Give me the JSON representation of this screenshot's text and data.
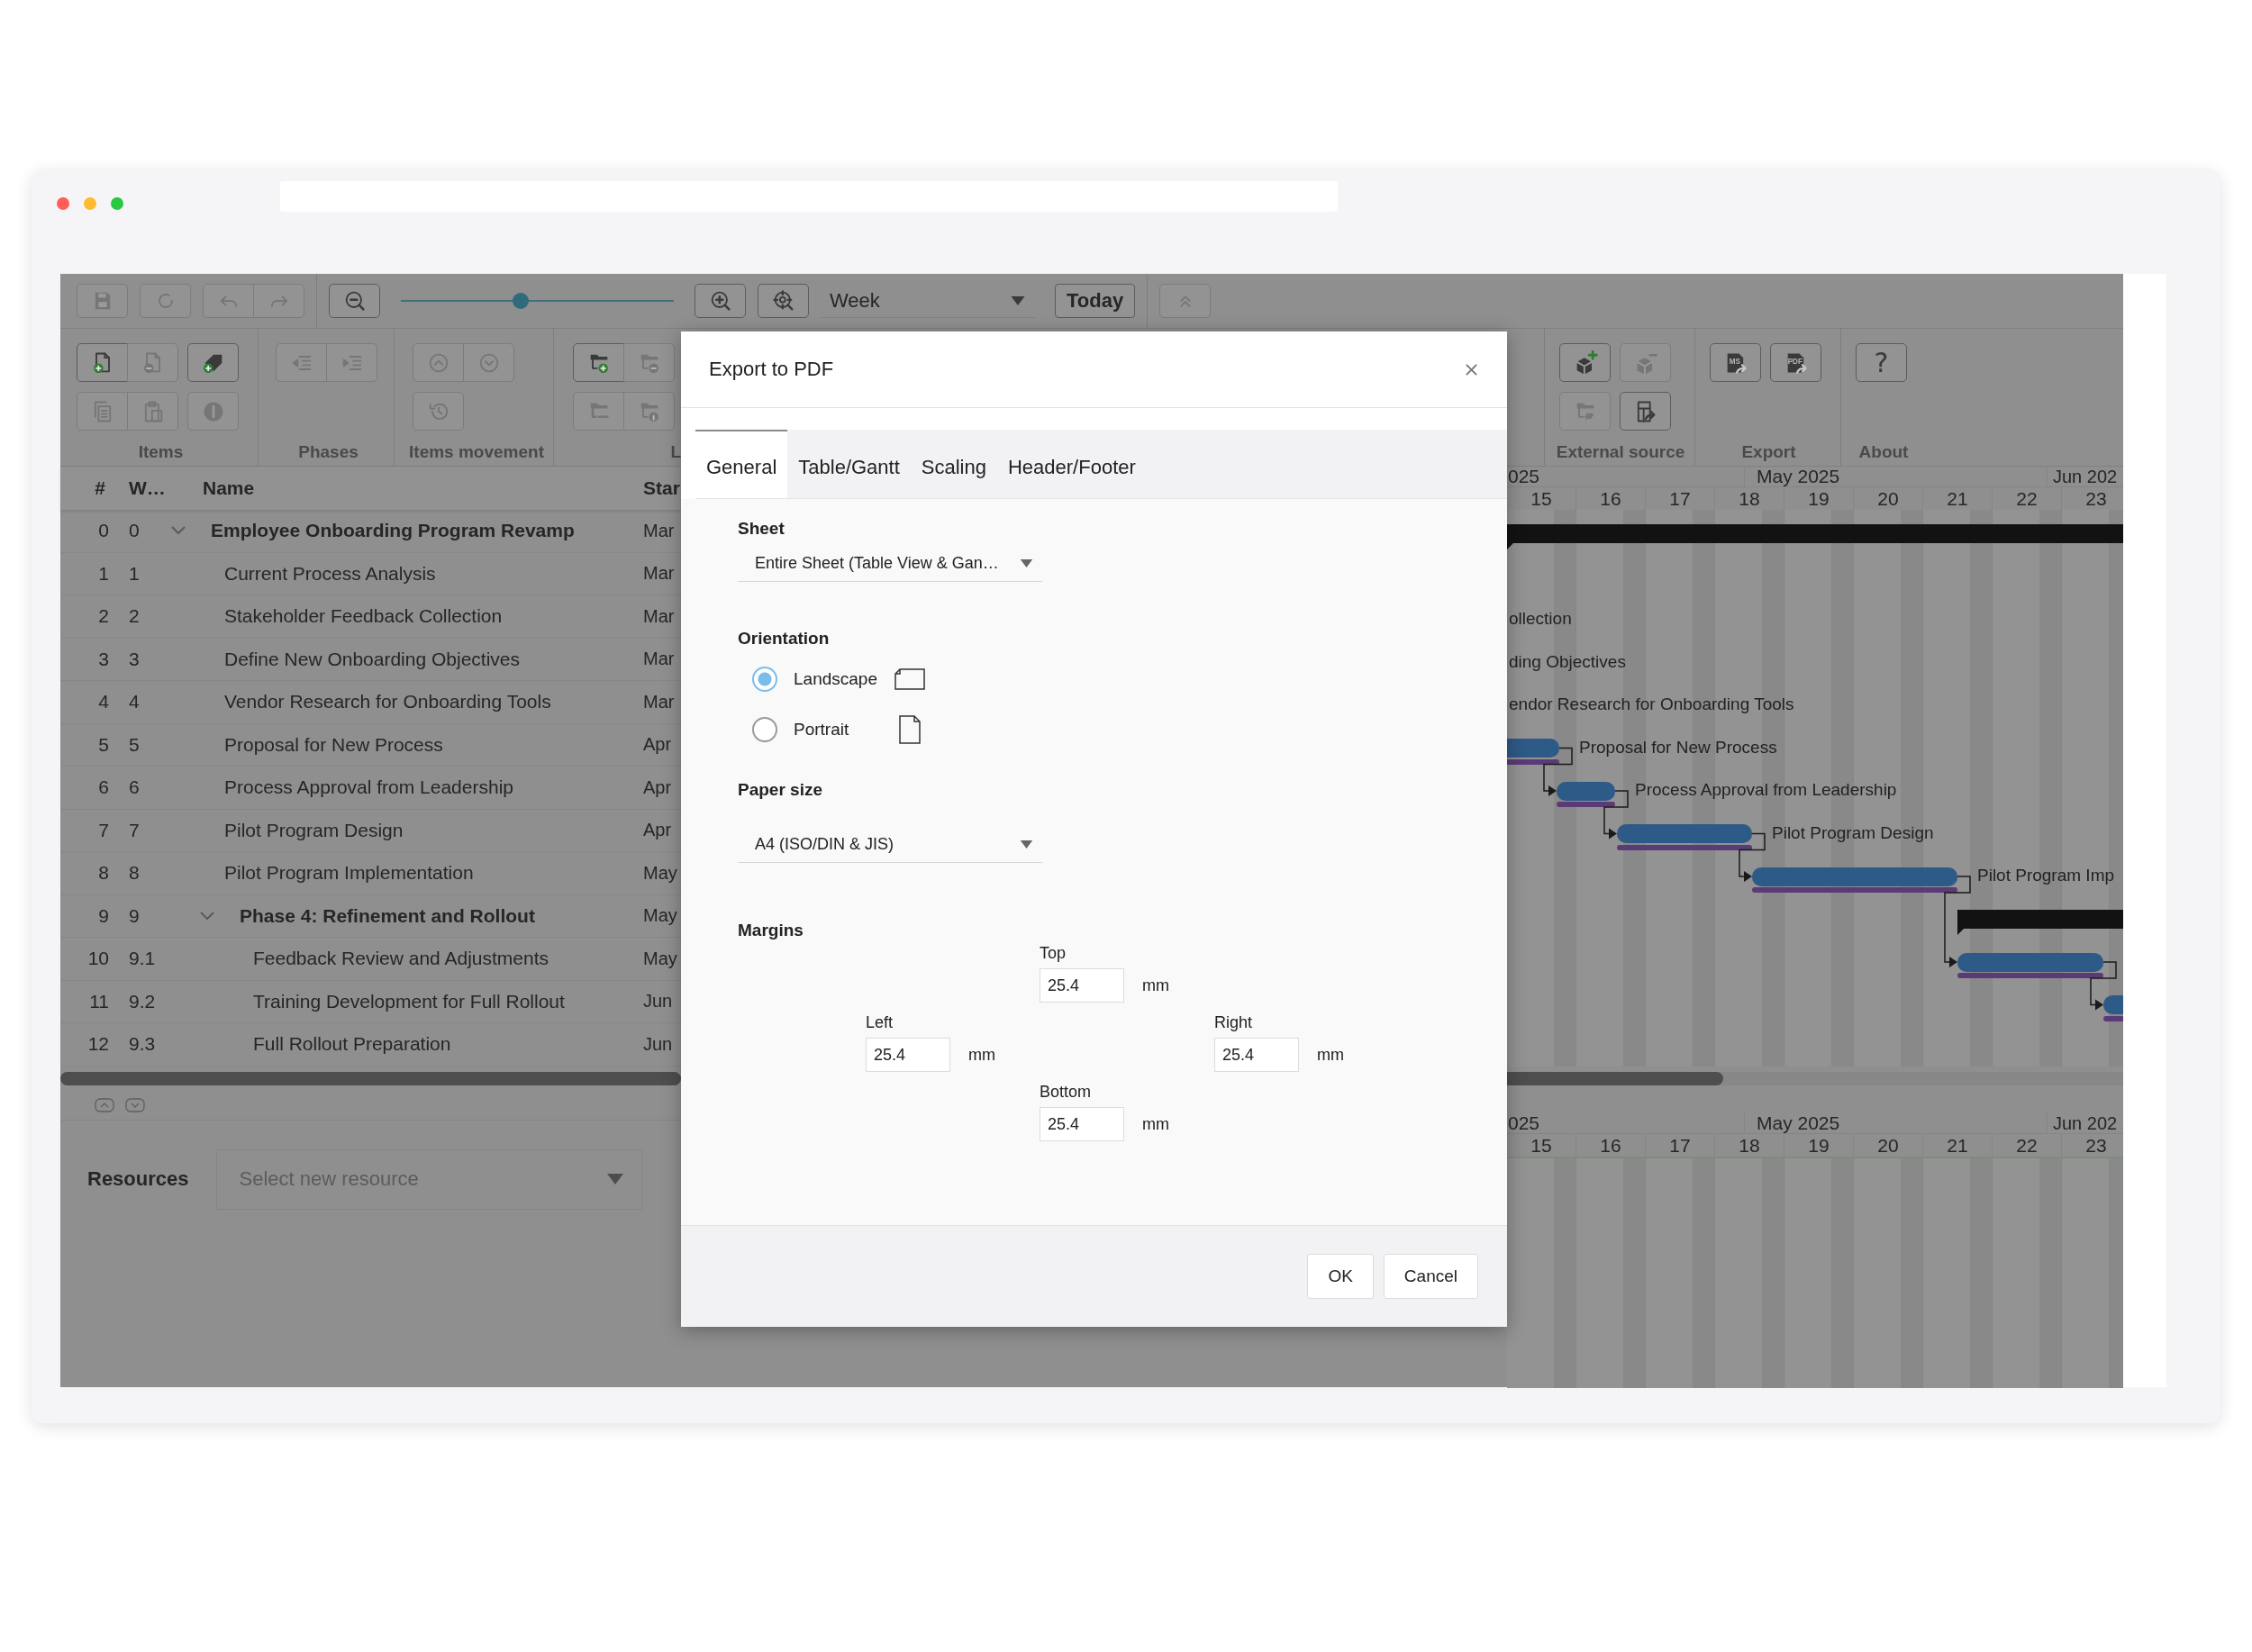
{
  "toolbar": {
    "file_buttons": [
      {
        "kind": "save",
        "disabled": true
      },
      {
        "kind": "refresh",
        "disabled": true
      }
    ],
    "history_buttons": [
      {
        "kind": "undo",
        "disabled": true
      },
      {
        "kind": "redo",
        "disabled": true
      }
    ],
    "zoom_out": {
      "kind": "zoom-out",
      "disabled": false
    },
    "zoom": {
      "level": 0.44
    },
    "view_buttons": [
      {
        "kind": "zoom-in",
        "disabled": false
      },
      {
        "kind": "zoom-fit",
        "disabled": false
      }
    ],
    "scale": {
      "value": "Week"
    },
    "today": {
      "label": "Today"
    },
    "collapse": {
      "kind": "collapse",
      "disabled": true
    }
  },
  "ribbon": {
    "groups": [
      {
        "label": "Items",
        "rows": [
          {
            "clusters": [
              {
                "buttons": [
                  {
                    "kind": "doc-plus",
                    "disabled": false
                  },
                  {
                    "kind": "doc-minus",
                    "disabled": true
                  }
                ]
              },
              {
                "buttons": [
                  {
                    "kind": "tag-plus",
                    "disabled": false
                  }
                ]
              }
            ]
          },
          {
            "clusters": [
              {
                "buttons": [
                  {
                    "kind": "copy",
                    "disabled": true
                  },
                  {
                    "kind": "paste",
                    "disabled": true
                  }
                ]
              },
              {
                "buttons": [
                  {
                    "kind": "info",
                    "disabled": true
                  }
                ]
              }
            ]
          }
        ]
      },
      {
        "label": "Phases",
        "rows": [
          {
            "clusters": [
              {
                "buttons": [
                  {
                    "kind": "outdent",
                    "disabled": true
                  },
                  {
                    "kind": "indent",
                    "disabled": true
                  }
                ]
              }
            ]
          }
        ]
      },
      {
        "label": "Items movement",
        "rows": [
          {
            "clusters": [
              {
                "buttons": [
                  {
                    "kind": "move-up",
                    "disabled": true
                  },
                  {
                    "kind": "move-down",
                    "disabled": true
                  }
                ]
              }
            ]
          },
          {
            "clusters": [
              {
                "buttons": [
                  {
                    "kind": "history",
                    "disabled": true
                  }
                ]
              }
            ]
          }
        ]
      },
      {
        "label": "L",
        "rows": [
          {
            "clusters": [
              {
                "buttons": [
                  {
                    "kind": "folder-plus",
                    "disabled": false
                  },
                  {
                    "kind": "folder-minus",
                    "disabled": true
                  }
                ]
              }
            ]
          },
          {
            "clusters": [
              {
                "buttons": [
                  {
                    "kind": "folder-out",
                    "disabled": true
                  },
                  {
                    "kind": "folder-info",
                    "disabled": true
                  }
                ]
              }
            ]
          }
        ]
      },
      {
        "label": "External source",
        "rows": [
          {
            "clusters": [
              {
                "buttons": [
                  {
                    "kind": "cube-plus",
                    "disabled": false
                  }
                ]
              },
              {
                "buttons": [
                  {
                    "kind": "cube-minus",
                    "disabled": true
                  }
                ]
              }
            ]
          },
          {
            "clusters": [
              {
                "buttons": [
                  {
                    "kind": "folder-link",
                    "disabled": true
                  }
                ]
              },
              {
                "buttons": [
                  {
                    "kind": "table-export",
                    "disabled": false
                  }
                ]
              }
            ]
          }
        ]
      },
      {
        "label": "Export",
        "rows": [
          {
            "clusters": [
              {
                "buttons": [
                  {
                    "kind": "doc-export",
                    "label": "MS",
                    "disabled": false
                  }
                ]
              },
              {
                "buttons": [
                  {
                    "kind": "doc-export",
                    "label": "PDF",
                    "disabled": false
                  }
                ]
              }
            ]
          }
        ]
      },
      {
        "label": "About",
        "rows": [
          {
            "clusters": [
              {
                "buttons": [
                  {
                    "kind": "help",
                    "label": "?",
                    "disabled": false
                  }
                ]
              }
            ]
          }
        ]
      }
    ]
  },
  "table": {
    "columns": [
      {
        "label": "#"
      },
      {
        "label": "W…"
      },
      {
        "label": "Name"
      },
      {
        "label": "Star"
      }
    ],
    "rows": [
      {
        "num": "0",
        "wbs": "0",
        "name": "Employee Onboarding Program Revamp",
        "start": "Mar",
        "expanded": true,
        "children": [
          {
            "num": "1",
            "wbs": "1",
            "name": "Current Process Analysis",
            "start": "Mar"
          },
          {
            "num": "2",
            "wbs": "2",
            "name": "Stakeholder Feedback Collection",
            "start": "Mar"
          },
          {
            "num": "3",
            "wbs": "3",
            "name": "Define New Onboarding Objectives",
            "start": "Mar"
          },
          {
            "num": "4",
            "wbs": "4",
            "name": "Vendor Research for Onboarding Tools",
            "start": "Mar"
          },
          {
            "num": "5",
            "wbs": "5",
            "name": "Proposal for New Process",
            "start": "Apr"
          },
          {
            "num": "6",
            "wbs": "6",
            "name": "Process Approval from Leadership",
            "start": "Apr"
          },
          {
            "num": "7",
            "wbs": "7",
            "name": "Pilot Program Design",
            "start": "Apr"
          },
          {
            "num": "8",
            "wbs": "8",
            "name": "Pilot Program Implementation",
            "start": "May"
          },
          {
            "num": "9",
            "wbs": "9",
            "name": "Phase 4: Refinement and Rollout",
            "start": "May",
            "expanded": true,
            "children": [
              {
                "num": "10",
                "wbs": "9.1",
                "name": "Feedback Review and Adjustments",
                "start": "May"
              },
              {
                "num": "11",
                "wbs": "9.2",
                "name": "Training Development for Full Rollout",
                "start": "Jun"
              },
              {
                "num": "12",
                "wbs": "9.3",
                "name": "Full Rollout Preparation",
                "start": "Jun"
              }
            ]
          }
        ]
      }
    ]
  },
  "gantt": {
    "months": [
      {
        "label": "025"
      },
      {
        "label": "May 2025"
      },
      {
        "label": "Jun 202"
      }
    ],
    "weeks": [
      "15",
      "16",
      "17",
      "18",
      "19",
      "20",
      "21",
      "22",
      "23"
    ],
    "rows": [
      {
        "kind": "summary"
      },
      {},
      {
        "label": "ollection"
      },
      {
        "label": "ding Objectives"
      },
      {
        "label": "endor Research for Onboarding Tools"
      },
      {
        "kind": "task",
        "label": "Proposal for New Process"
      },
      {
        "kind": "task",
        "label": "Process Approval from Leadership"
      },
      {
        "kind": "task",
        "label": "Pilot Program Design"
      },
      {
        "kind": "task",
        "label": "Pilot Program Imp"
      },
      {
        "kind": "summary"
      },
      {
        "kind": "task"
      },
      {
        "kind": "task"
      },
      {}
    ]
  },
  "resources": {
    "label": "Resources",
    "placeholder": "Select new resource"
  },
  "bottom_timeline": {
    "months": [
      {
        "label": "025"
      },
      {
        "label": "May 2025"
      },
      {
        "label": "Jun 202"
      }
    ],
    "weeks": [
      "15",
      "16",
      "17",
      "18",
      "19",
      "20",
      "21",
      "22",
      "23"
    ]
  },
  "dialog": {
    "title": "Export to PDF",
    "tabs": [
      {
        "label": "General",
        "selected": true
      },
      {
        "label": "Table/Gantt",
        "selected": false
      },
      {
        "label": "Scaling",
        "selected": false
      },
      {
        "label": "Header/Footer",
        "selected": false
      }
    ],
    "sheet": {
      "label": "Sheet",
      "value": "Entire Sheet (Table View & Gan…"
    },
    "orientation": {
      "label": "Orientation",
      "options": [
        {
          "kind": "landscape",
          "label": "Landscape",
          "selected": true
        },
        {
          "kind": "portrait",
          "label": "Portrait",
          "selected": false
        }
      ]
    },
    "paper_size": {
      "label": "Paper size",
      "value": "A4 (ISO/DIN & JIS)"
    },
    "margins": {
      "label": "Margins",
      "fields": [
        {
          "kind": "top",
          "label": "Top",
          "value": "25.4",
          "unit": "mm"
        },
        {
          "kind": "left",
          "label": "Left",
          "value": "25.4",
          "unit": "mm"
        },
        {
          "kind": "right",
          "label": "Right",
          "value": "25.4",
          "unit": "mm"
        },
        {
          "kind": "bottom",
          "label": "Bottom",
          "value": "25.4",
          "unit": "mm"
        }
      ]
    },
    "buttons": [
      {
        "label": "OK"
      },
      {
        "label": "Cancel"
      }
    ]
  }
}
